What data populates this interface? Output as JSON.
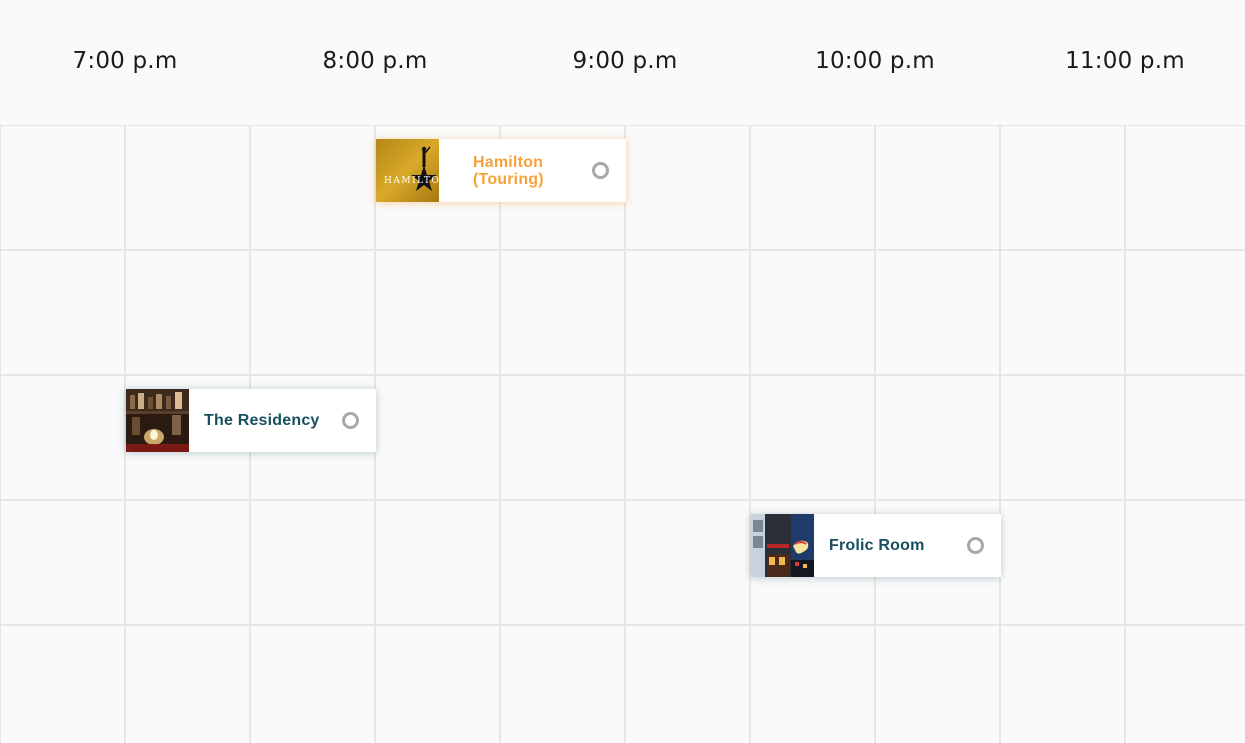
{
  "timeline": {
    "times": [
      "7:00 p.m",
      "8:00 p.m",
      "9:00 p.m",
      "10:00 p.m",
      "11:00 p.m"
    ]
  },
  "events": [
    {
      "title": "Hamilton (Touring)",
      "thumbnail": "hamilton-poster-image",
      "accent": "#f6a23c",
      "thumbnail_text": "HAMILTON"
    },
    {
      "title": "The Residency",
      "thumbnail": "bar-candle-image",
      "accent": "#174f5e"
    },
    {
      "title": "Frolic Room",
      "thumbnail": "storefront-neon-image",
      "accent": "#174f5e"
    }
  ],
  "colors": {
    "background": "#fafafa",
    "grid_line": "#e6e6e6",
    "teal_text": "#174f5e",
    "orange_text": "#f6a23c",
    "radio": "#a8a8a8"
  }
}
